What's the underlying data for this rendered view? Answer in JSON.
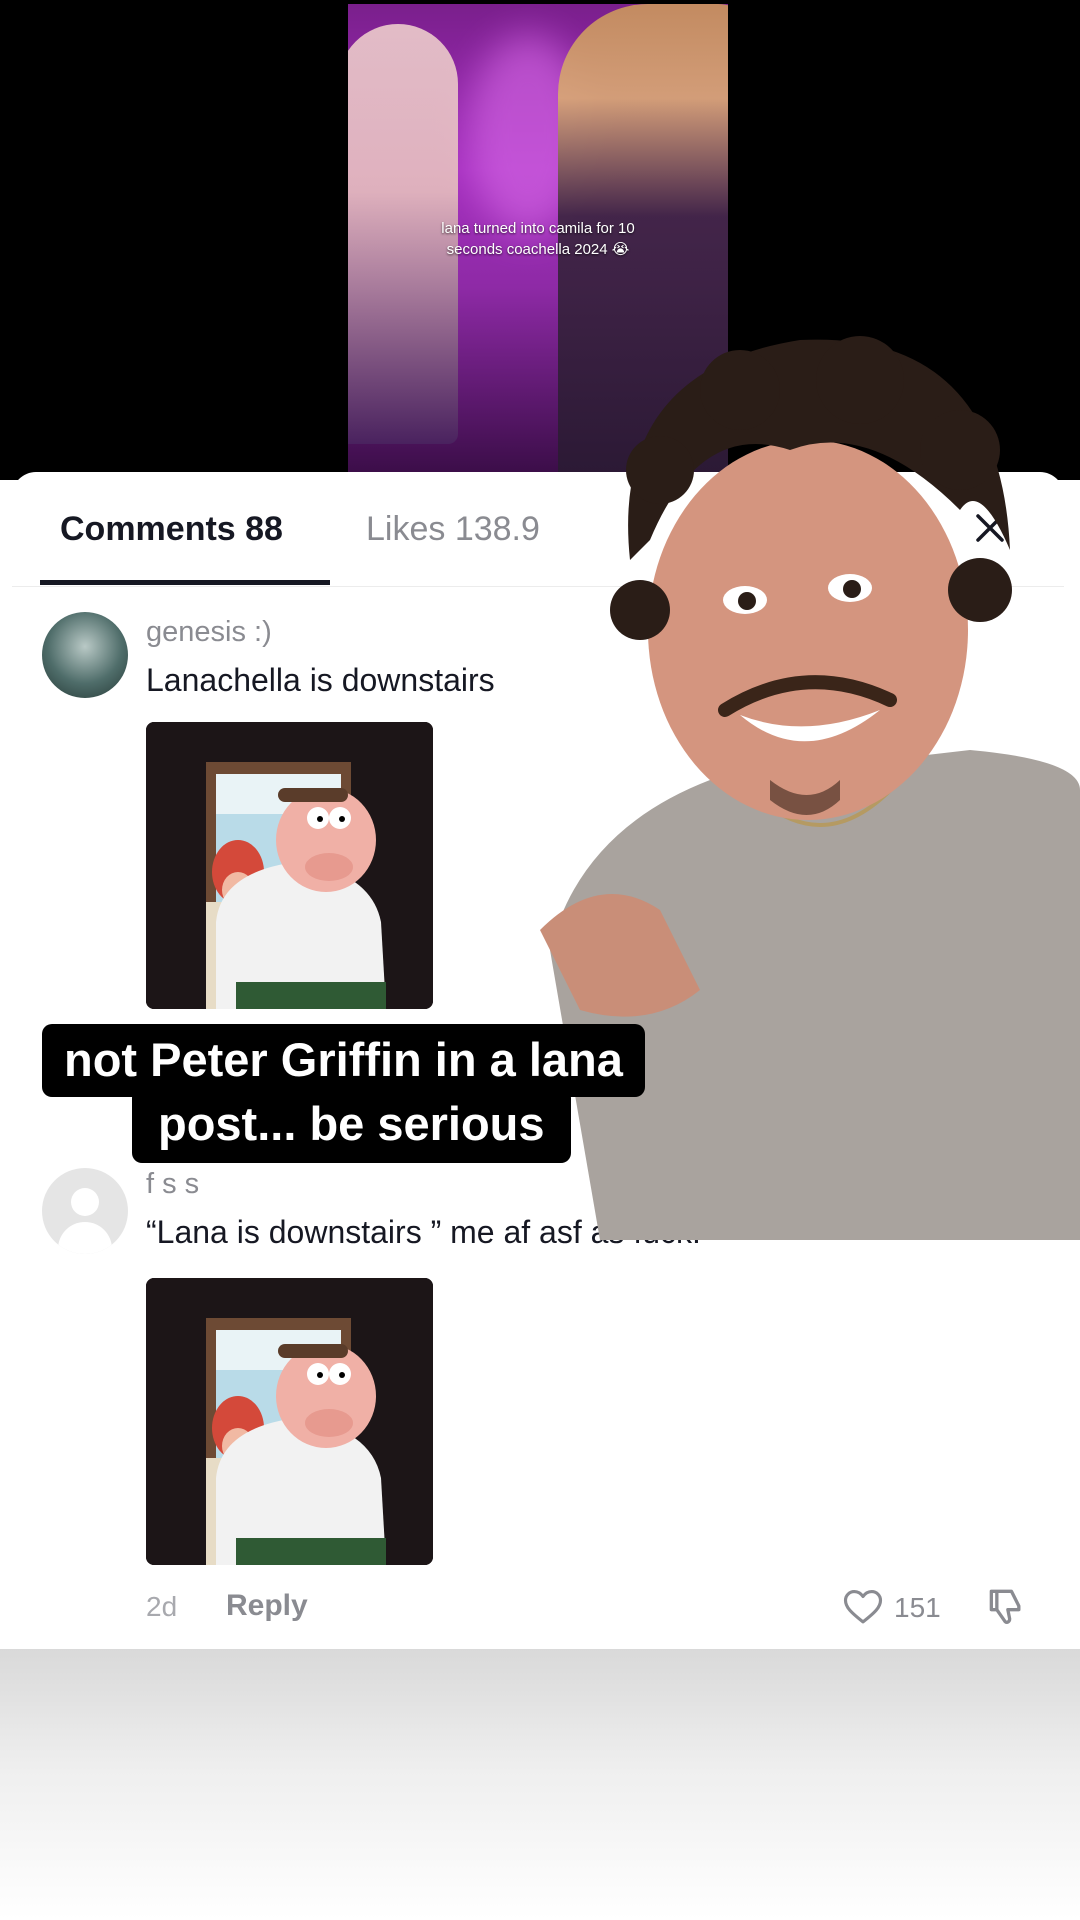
{
  "video": {
    "caption_line1": "lana turned into camila for 10",
    "caption_line2": "seconds coachella 2024 😭"
  },
  "tabs": {
    "comments": "Comments 88",
    "likes": "Likes 138.9"
  },
  "comments": [
    {
      "username": "genesis :)",
      "text": "Lanachella is downstairs"
    },
    {
      "username": "f s s",
      "text": "“Lana is downstairs ” me af asf as fuck:",
      "date": "2d",
      "reply_label": "Reply",
      "likes": "151"
    }
  ],
  "subtitle": {
    "line1": "not Peter Griffin in a lana",
    "line2": "post... be serious"
  },
  "icons": {
    "close": "close-icon",
    "like": "heart-icon",
    "dislike": "thumbs-down-icon"
  },
  "colors": {
    "text_primary": "#161823",
    "text_secondary": "#8a8b91",
    "video_purple": "#a52fbf"
  }
}
